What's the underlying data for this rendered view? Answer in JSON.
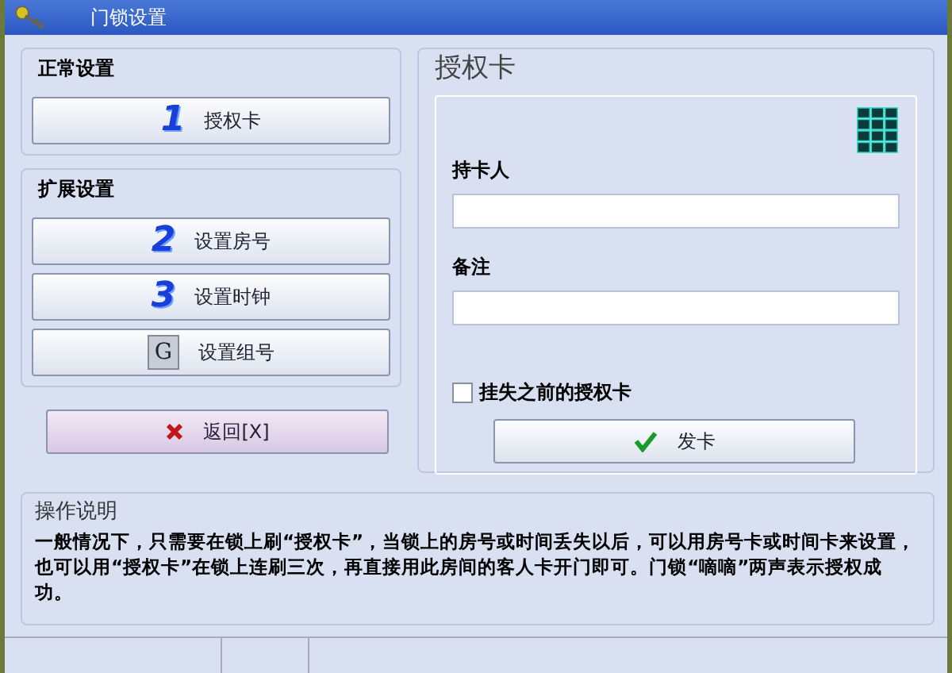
{
  "window": {
    "title": "门锁设置"
  },
  "left": {
    "groups": [
      {
        "title": "正常设置",
        "buttons": [
          {
            "badge": "1",
            "kind": "number",
            "label": "授权卡"
          }
        ]
      },
      {
        "title": "扩展设置",
        "buttons": [
          {
            "badge": "2",
            "kind": "number",
            "label": "设置房号"
          },
          {
            "badge": "3",
            "kind": "number",
            "label": "设置时钟"
          },
          {
            "badge": "G",
            "kind": "tile",
            "label": "设置组号"
          }
        ]
      }
    ],
    "back_button": {
      "label": "返回[X]"
    }
  },
  "card_panel": {
    "title": "授权卡",
    "fields": [
      {
        "label": "持卡人"
      },
      {
        "label": "备注"
      }
    ],
    "checkbox": {
      "label": "挂失之前的授权卡",
      "checked": false
    },
    "issue_button": {
      "label": "发卡"
    }
  },
  "help": {
    "title": "操作说明",
    "text": "一般情况下，只需要在锁上刷“授权卡”，当锁上的房号或时间丢失以后，可以用房号卡或时间卡来设置，也可以用“授权卡”在锁上连刷三次，再直接用此房间的客人卡开门即可。门锁“嘀嘀”两声表示授权成功。"
  }
}
